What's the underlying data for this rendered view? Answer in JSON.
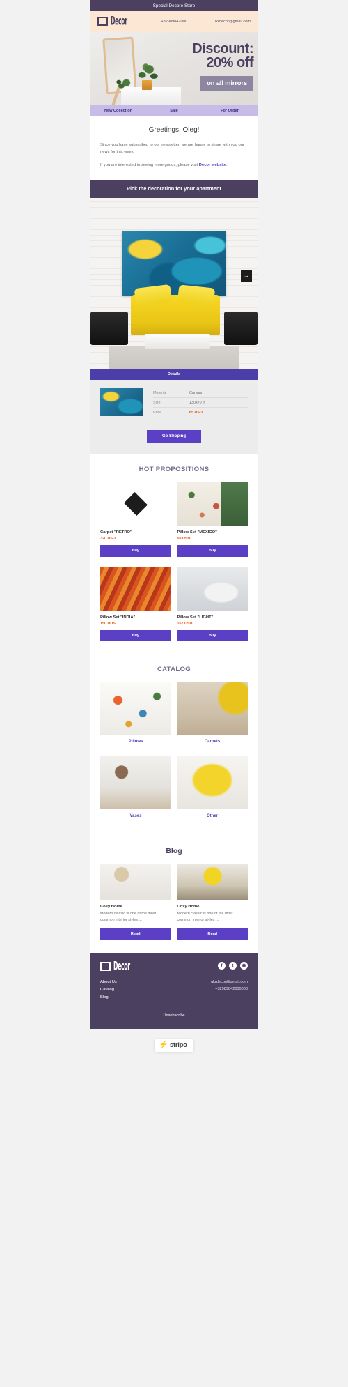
{
  "preheader": {
    "text": "Special Decore Store"
  },
  "header": {
    "logo_text": "Decor",
    "phone": "+32989842000",
    "email": "ukrdecor@gmail.com"
  },
  "hero": {
    "line1": "Discount:",
    "line2": "20% off",
    "tag": "on all mirrors"
  },
  "nav": {
    "items": [
      {
        "label": "New Collection"
      },
      {
        "label": "Sale"
      },
      {
        "label": "For Order"
      }
    ]
  },
  "greeting": {
    "title": "Greetings, Oleg!",
    "paragraph1": "Since you have subscribed to our newsletter, we are happy to share with you our news for this week.",
    "paragraph2_pre": "If you are interested in seeing more goods, please visit ",
    "paragraph2_link": "Decor website",
    "paragraph2_post": "."
  },
  "feature": {
    "section_title": "Pick the decoration for your apartment",
    "next_icon": "→",
    "details_label": "Details"
  },
  "spec": {
    "rows": [
      {
        "key": "Material",
        "value": "Canvas"
      },
      {
        "key": "Size",
        "value": "130x70 in"
      },
      {
        "key": "Price",
        "value": "65 USD"
      }
    ],
    "cta": "Go Shoping"
  },
  "hot": {
    "heading": "HOT PROPOSITIONS",
    "products": [
      {
        "name": "Carpet \"RETRO\"",
        "price": "320 USD",
        "button": "Buy",
        "texture": "tex-carpet"
      },
      {
        "name": "Pillow Set \"MEXICO\"",
        "price": "50 USD",
        "button": "Buy",
        "texture": "tex-pillow-mex"
      },
      {
        "name": "Pillow Set \"INDIA\"",
        "price": "150 UDS",
        "button": "Buy",
        "texture": "tex-pillow-india"
      },
      {
        "name": "Pillow Set \"LIGHT\"",
        "price": "167 USD",
        "button": "Buy",
        "texture": "tex-pillow-light"
      }
    ]
  },
  "catalog": {
    "heading": "CATALOG",
    "items": [
      {
        "label": "Pillows",
        "texture": "tex-pillows-cat"
      },
      {
        "label": "Carpets",
        "texture": "tex-carpets-cat"
      },
      {
        "label": "Vases",
        "texture": "tex-vases-cat"
      },
      {
        "label": "Other",
        "texture": "tex-other-cat"
      }
    ]
  },
  "blog": {
    "heading": "Blog",
    "posts": [
      {
        "title": "Cosy Home",
        "excerpt": "Modern classic is one of the most common interior styles ...",
        "button": "Read",
        "texture": "tex-blog1"
      },
      {
        "title": "Cosy Home",
        "excerpt": "Modern classic is one of the most common interior styles ...",
        "button": "Read",
        "texture": "tex-blog2"
      }
    ]
  },
  "footer": {
    "logo_text": "Decor",
    "social": [
      {
        "name": "facebook-icon",
        "glyph": "f"
      },
      {
        "name": "twitter-icon",
        "glyph": "t"
      },
      {
        "name": "instagram-icon",
        "glyph": "◉"
      }
    ],
    "links": [
      {
        "label": "About Us"
      },
      {
        "label": "Catalog"
      },
      {
        "label": "Blog"
      }
    ],
    "email": "ukrdecor@gmail.com",
    "phone": "+32989842000000",
    "unsubscribe": "Unsubscribe"
  },
  "stripo": {
    "word": "stripo",
    "bolt": "⚡"
  },
  "colors": {
    "dark_purple": "#4c4061",
    "accent_purple": "#5b3fc4",
    "lilac_nav": "#c7bce8",
    "cream": "#fbe7d4",
    "price_orange": "#e8500e",
    "heading_grey": "#6d6e8c"
  }
}
